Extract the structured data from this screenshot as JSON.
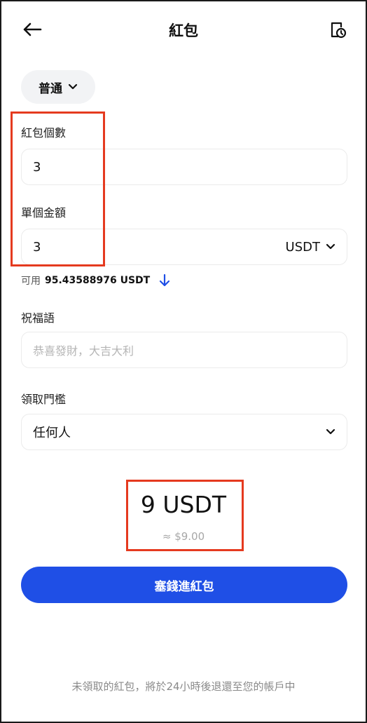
{
  "header": {
    "title": "紅包",
    "back_icon": "arrow-left-icon",
    "history_icon": "document-clock-icon"
  },
  "type_selector": {
    "label": "普通"
  },
  "count_field": {
    "label": "紅包個數",
    "value": "3"
  },
  "amount_field": {
    "label": "單個金額",
    "value": "3",
    "currency": "USDT"
  },
  "available": {
    "label": "可用",
    "amount": "95.43588976 USDT"
  },
  "greeting_field": {
    "label": "祝福語",
    "placeholder": "恭喜發財，大吉大利"
  },
  "threshold_field": {
    "label": "領取門檻",
    "value": "任何人"
  },
  "summary": {
    "total": "9 USDT",
    "fiat": "≈ $9.00"
  },
  "submit": {
    "label": "塞錢進紅包"
  },
  "footnote": "未領取的紅包，將於24小時後退還至您的帳戶中",
  "colors": {
    "accent": "#1f4fe6",
    "highlight": "#e53a1f",
    "field_border": "#ebebeb",
    "pill_bg": "#f2f3f5"
  }
}
